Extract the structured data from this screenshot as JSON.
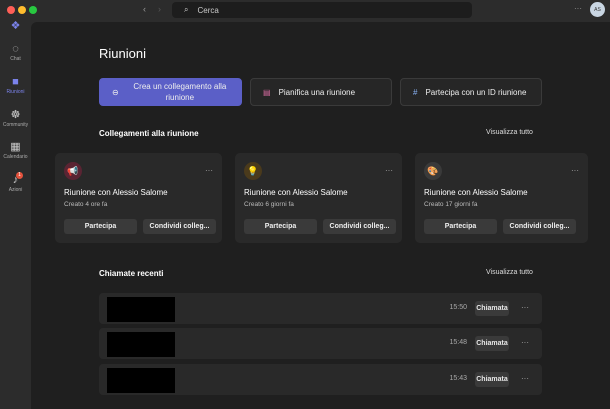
{
  "titlebar": {
    "search_placeholder": "Cerca",
    "avatar": "AS"
  },
  "sidebar": {
    "items": [
      {
        "label": "Chat"
      },
      {
        "label": "Riunioni"
      },
      {
        "label": "Community"
      },
      {
        "label": "Calendario"
      },
      {
        "label": "Azioni",
        "badge": "1"
      }
    ]
  },
  "main": {
    "title": "Riunioni",
    "actions": [
      {
        "label": "Crea un collegamento alla riunione"
      },
      {
        "label": "Pianifica una riunione"
      },
      {
        "label": "Partecipa con un ID riunione"
      }
    ],
    "links_section": {
      "title": "Collegamenti alla riunione",
      "view_all": "Visualizza tutto"
    },
    "cards": [
      {
        "title": "Riunione con Alessio Salome",
        "subtitle": "Creato 4 ore fa",
        "join": "Partecipa",
        "share": "Condividi colleg..."
      },
      {
        "title": "Riunione con Alessio Salome",
        "subtitle": "Creato 6 giorni fa",
        "join": "Partecipa",
        "share": "Condividi colleg..."
      },
      {
        "title": "Riunione con Alessio Salome",
        "subtitle": "Creato 17 giorni fa",
        "join": "Partecipa",
        "share": "Condividi colleg..."
      }
    ],
    "calls_section": {
      "title": "Chiamate recenti",
      "view_all": "Visualizza tutto"
    },
    "calls": [
      {
        "time": "15:50",
        "action": "Chiamata"
      },
      {
        "time": "15:48",
        "action": "Chiamata"
      },
      {
        "time": "15:43",
        "action": "Chiamata"
      }
    ]
  },
  "colors": {
    "accent": "#5b5fc7"
  }
}
